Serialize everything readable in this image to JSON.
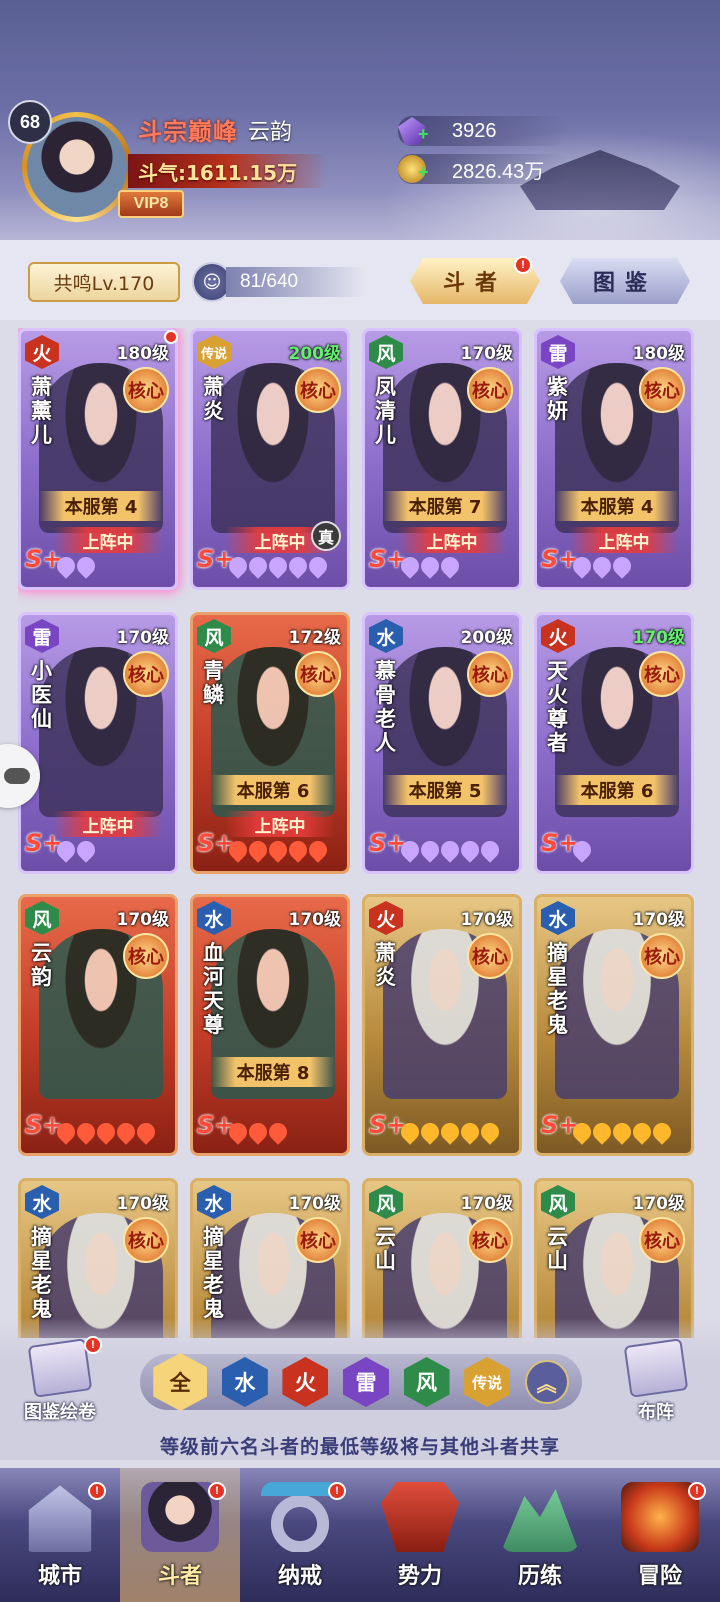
{
  "player": {
    "level": "68",
    "rank_title": "斗宗巅峰",
    "name": "云韵",
    "power": "斗气:1611.15万",
    "vip": "VIP8"
  },
  "resources": {
    "crystal": "3926",
    "gold": "2826.43万"
  },
  "toolbar": {
    "resonance": "共鸣Lv.170",
    "slots": "81/640",
    "tab_fighters": "斗者",
    "tab_codex": "图鉴"
  },
  "cards": [
    {
      "element": "火",
      "el_class": "el-fire",
      "level": "180级",
      "level_color": "white",
      "name": "萧薰儿",
      "frame": "purple",
      "pink": true,
      "core": "核心",
      "rank": "本服第 4",
      "deployed": "上阵中",
      "stars": 2
    },
    {
      "element": "传说",
      "el_class": "el-legend",
      "level": "200级",
      "level_color": "green",
      "name": "萧炎",
      "frame": "purple",
      "core": "核心",
      "rank": "",
      "deployed": "上阵中",
      "stars": 5,
      "zhen": "真"
    },
    {
      "element": "风",
      "el_class": "el-wind",
      "level": "170级",
      "level_color": "white",
      "name": "凤清儿",
      "frame": "purple",
      "core": "核心",
      "rank": "本服第 7",
      "deployed": "上阵中",
      "stars": 3
    },
    {
      "element": "雷",
      "el_class": "el-thunder",
      "level": "180级",
      "level_color": "white",
      "name": "紫妍",
      "frame": "purple",
      "core": "核心",
      "rank": "本服第 4",
      "deployed": "上阵中",
      "stars": 3
    },
    {
      "element": "雷",
      "el_class": "el-thunder",
      "level": "170级",
      "level_color": "white",
      "name": "小医仙",
      "frame": "purple",
      "core": "核心",
      "rank": "",
      "deployed": "上阵中",
      "stars": 2
    },
    {
      "element": "风",
      "el_class": "el-wind",
      "level": "172级",
      "level_color": "white",
      "name": "青鳞",
      "frame": "red",
      "core": "核心",
      "rank": "本服第 6",
      "deployed": "上阵中",
      "stars": 5
    },
    {
      "element": "水",
      "el_class": "el-water",
      "level": "200级",
      "level_color": "white",
      "name": "慕骨老人",
      "frame": "purple",
      "core": "核心",
      "rank": "本服第 5",
      "deployed": "",
      "stars": 5
    },
    {
      "element": "火",
      "el_class": "el-fire",
      "level": "170级",
      "level_color": "green",
      "name": "天火尊者",
      "frame": "purple",
      "core": "核心",
      "rank": "本服第 6",
      "deployed": "",
      "stars": 1
    },
    {
      "element": "风",
      "el_class": "el-wind",
      "level": "170级",
      "level_color": "white",
      "name": "云韵",
      "frame": "red",
      "core": "核心",
      "rank": "",
      "deployed": "",
      "stars": 5
    },
    {
      "element": "水",
      "el_class": "el-water",
      "level": "170级",
      "level_color": "white",
      "name": "血河天尊",
      "frame": "red",
      "core": "",
      "rank": "本服第 8",
      "deployed": "",
      "stars": 3
    },
    {
      "element": "火",
      "el_class": "el-fire",
      "level": "170级",
      "level_color": "white",
      "name": "萧炎",
      "frame": "gold",
      "core": "核心",
      "rank": "",
      "deployed": "",
      "stars": 5
    },
    {
      "element": "水",
      "el_class": "el-water",
      "level": "170级",
      "level_color": "white",
      "name": "摘星老鬼",
      "frame": "gold",
      "core": "核心",
      "rank": "",
      "deployed": "",
      "stars": 5
    },
    {
      "element": "水",
      "el_class": "el-water",
      "level": "170级",
      "level_color": "white",
      "name": "摘星老鬼",
      "frame": "gold",
      "core": "核心",
      "rank": "",
      "deployed": "",
      "stars": 0
    },
    {
      "element": "水",
      "el_class": "el-water",
      "level": "170级",
      "level_color": "white",
      "name": "摘星老鬼",
      "frame": "gold",
      "core": "核心",
      "rank": "",
      "deployed": "",
      "stars": 0
    },
    {
      "element": "风",
      "el_class": "el-wind",
      "level": "170级",
      "level_color": "white",
      "name": "云山",
      "frame": "gold",
      "core": "核心",
      "rank": "",
      "deployed": "",
      "stars": 0
    },
    {
      "element": "风",
      "el_class": "el-wind",
      "level": "170级",
      "level_color": "white",
      "name": "云山",
      "frame": "gold",
      "core": "核心",
      "rank": "",
      "deployed": "",
      "stars": 0
    }
  ],
  "filter": {
    "codex_scroll": "图鉴绘卷",
    "formation": "布阵",
    "chips": [
      "全",
      "水",
      "火",
      "雷",
      "风",
      "传说"
    ],
    "hint": "等级前六名斗者的最低等级将与其他斗者共享"
  },
  "nav": [
    {
      "label": "城市",
      "icon": "ni-city",
      "active": false
    },
    {
      "label": "斗者",
      "icon": "ni-fighter",
      "active": true
    },
    {
      "label": "纳戒",
      "icon": "ni-ring",
      "active": false
    },
    {
      "label": "势力",
      "icon": "ni-force",
      "active": false
    },
    {
      "label": "历练",
      "icon": "ni-train",
      "active": false
    },
    {
      "label": "冒险",
      "icon": "ni-adventure",
      "active": false
    }
  ],
  "colors": {
    "fire": "#c8321f",
    "wind": "#2f8b4a",
    "water": "#2a5fb0",
    "thunder": "#7a45c2",
    "legend": "#d9a132"
  }
}
